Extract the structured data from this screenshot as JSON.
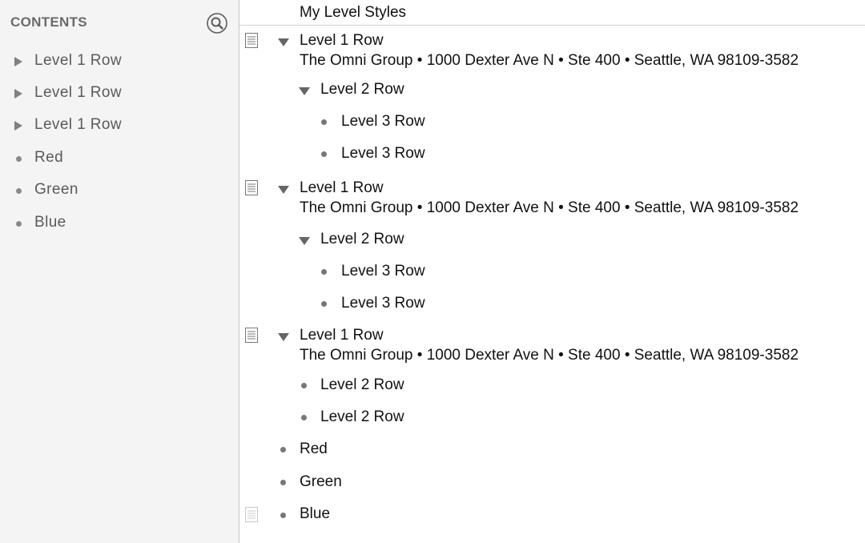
{
  "sidebar": {
    "header": "CONTENTS",
    "items": [
      {
        "label": "Level 1 Row",
        "kind": "expandable"
      },
      {
        "label": "Level 1 Row",
        "kind": "expandable"
      },
      {
        "label": "Level 1 Row",
        "kind": "expandable"
      },
      {
        "label": "Red",
        "kind": "leaf"
      },
      {
        "label": "Green",
        "kind": "leaf"
      },
      {
        "label": "Blue",
        "kind": "leaf"
      }
    ]
  },
  "outline": {
    "column_title": "My Level Styles",
    "groups": [
      {
        "level1": "Level 1 Row",
        "note": "The Omni Group • 1000 Dexter Ave N • Ste 400 • Seattle, WA 98109-3582",
        "level2": "Level 2 Row",
        "level3": [
          "Level 3 Row",
          "Level 3 Row"
        ]
      },
      {
        "level1": "Level 1 Row",
        "note": "The Omni Group • 1000 Dexter Ave N • Ste 400 • Seattle, WA 98109-3582",
        "level2": "Level 2 Row",
        "level3": [
          "Level 3 Row",
          "Level 3 Row"
        ]
      },
      {
        "level1": "Level 1 Row",
        "note": "The Omni Group • 1000 Dexter Ave N • Ste 400 • Seattle, WA 98109-3582",
        "level2_items": [
          "Level 2 Row",
          "Level 2 Row"
        ]
      }
    ],
    "leaves": [
      "Red",
      "Green",
      "Blue"
    ]
  },
  "icons": {
    "search": "search-icon",
    "note": "note-icon",
    "disclosure_collapsed": "disclosure-right-icon",
    "disclosure_expanded": "disclosure-down-icon",
    "bullet": "bullet-icon"
  }
}
